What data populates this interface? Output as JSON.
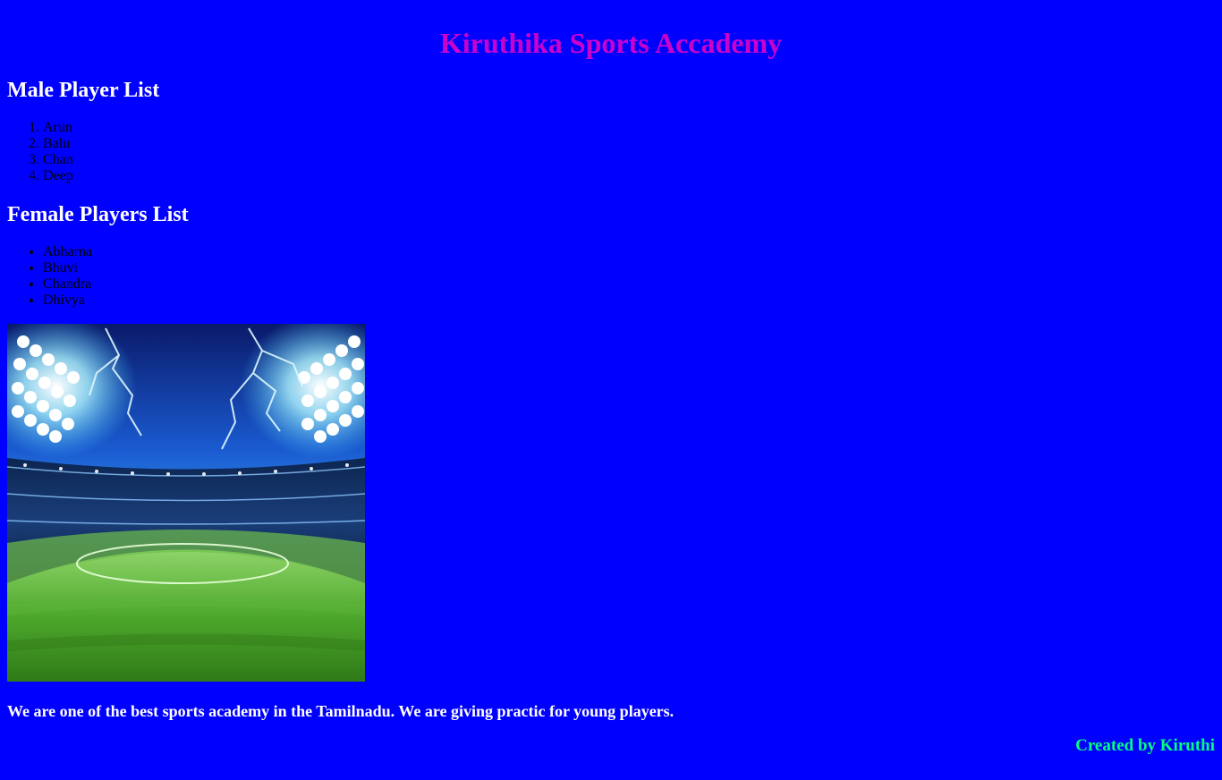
{
  "header": {
    "title": "Kiruthika Sports Accademy"
  },
  "male_section": {
    "heading": "Male Player List",
    "players": [
      "Arun",
      "Balu",
      "Chan",
      "Deep"
    ]
  },
  "female_section": {
    "heading": "Female Players List",
    "players": [
      "Abharna",
      "Bhuvi",
      "Chandra",
      "Dhivya"
    ]
  },
  "image": {
    "subject": "stadium-image"
  },
  "about": {
    "text": "We are one of the best sports academy in the Tamilnadu. We are giving practic for young players."
  },
  "footer": {
    "credit": "Created by Kiruthi"
  },
  "colors": {
    "background": "#0000ff",
    "title": "#cc00cc",
    "headings": "#ffffff",
    "credit": "#00ff7f"
  }
}
